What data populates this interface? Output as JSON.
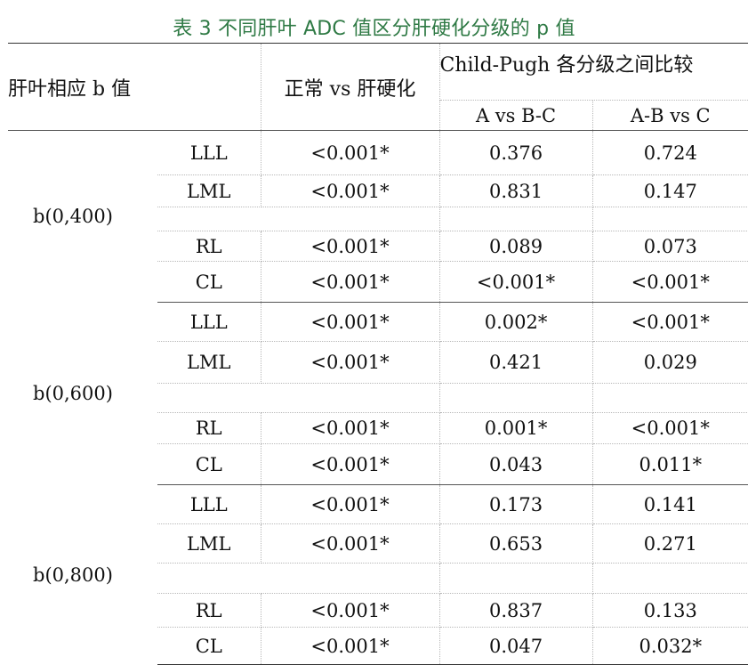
{
  "caption": "表 3 不同肝叶 ADC 值区分肝硬化分级的 p 值",
  "header": {
    "col_lobe": "肝叶相应 b 值",
    "col_normal": "正常 vs 肝硬化",
    "col_child": "Child-Pugh 各分级之间比较",
    "sub_a": "A vs B-C",
    "sub_b": "A-B vs C"
  },
  "groups": [
    {
      "label": "b(0,400)",
      "rows": [
        {
          "lobe": "LLL",
          "normal": "<0.001*",
          "a_vs_bc": "0.376",
          "ab_vs_c": "0.724"
        },
        {
          "lobe": "LML",
          "normal": "<0.001*",
          "a_vs_bc": "0.831",
          "ab_vs_c": "0.147"
        },
        {
          "lobe": "RL",
          "normal": "<0.001*",
          "a_vs_bc": "0.089",
          "ab_vs_c": "0.073"
        },
        {
          "lobe": "CL",
          "normal": "<0.001*",
          "a_vs_bc": "<0.001*",
          "ab_vs_c": "<0.001*"
        }
      ]
    },
    {
      "label": "b(0,600)",
      "rows": [
        {
          "lobe": "LLL",
          "normal": "<0.001*",
          "a_vs_bc": "0.002*",
          "ab_vs_c": "<0.001*"
        },
        {
          "lobe": "LML",
          "normal": "<0.001*",
          "a_vs_bc": "0.421",
          "ab_vs_c": "0.029"
        },
        {
          "lobe": "RL",
          "normal": "<0.001*",
          "a_vs_bc": "0.001*",
          "ab_vs_c": "<0.001*"
        },
        {
          "lobe": "CL",
          "normal": "<0.001*",
          "a_vs_bc": "0.043",
          "ab_vs_c": "0.011*"
        }
      ]
    },
    {
      "label": "b(0,800)",
      "rows": [
        {
          "lobe": "LLL",
          "normal": "<0.001*",
          "a_vs_bc": "0.173",
          "ab_vs_c": "0.141"
        },
        {
          "lobe": "LML",
          "normal": "<0.001*",
          "a_vs_bc": "0.653",
          "ab_vs_c": "0.271"
        },
        {
          "lobe": "RL",
          "normal": "<0.001*",
          "a_vs_bc": "0.837",
          "ab_vs_c": "0.133"
        },
        {
          "lobe": "CL",
          "normal": "<0.001*",
          "a_vs_bc": "0.047",
          "ab_vs_c": "0.032*"
        }
      ]
    }
  ]
}
